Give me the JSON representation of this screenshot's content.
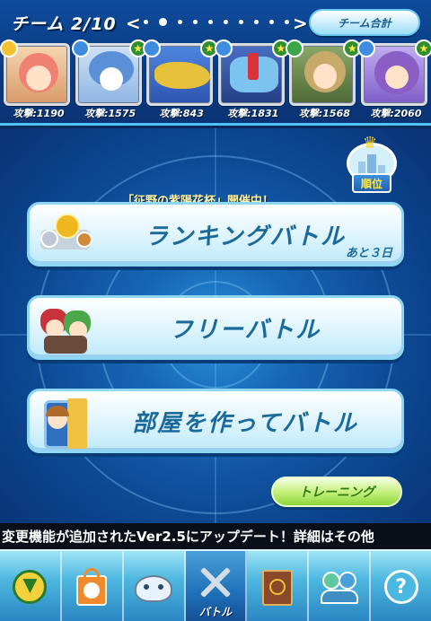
{
  "header": {
    "team_label": "チーム 2/10",
    "prev_arrow": "<",
    "next_arrow": ">",
    "team_total_button": "チーム合計",
    "page_dots": 10,
    "active_dot": 2
  },
  "team": [
    {
      "atk": "攻撃:1190",
      "attr_color": "#f2c230",
      "hair": "#f08070",
      "bg": "#e9b38a"
    },
    {
      "atk": "攻撃:1575",
      "attr_color": "#3f8de0",
      "hair": "#5b8fd8",
      "bg": "#9ec0e8"
    },
    {
      "atk": "攻撃:843",
      "attr_color": "#3f8de0",
      "hair": "#e8c13a",
      "bg": "#3b6fd0"
    },
    {
      "atk": "攻撃:1831",
      "attr_color": "#3f8de0",
      "hair": "#7cc3f0",
      "bg": "#3a5fb0"
    },
    {
      "atk": "攻撃:1568",
      "attr_color": "#3aa64a",
      "hair": "#c7a96a",
      "bg": "#6a8a4a"
    },
    {
      "atk": "攻撃:2060",
      "attr_color": "#3f8de0",
      "hair": "#8a5ec4",
      "bg": "#9c7bd8"
    }
  ],
  "ranking_badge": "順位",
  "event_notice": "「征野の紫陽花杯」開催中！",
  "menu": {
    "ranking_battle": "ランキングバトル",
    "ranking_remaining": "あと３日",
    "free_battle": "フリーバトル",
    "room_battle": "部屋を作ってバトル",
    "training": "トレーニング"
  },
  "ticker": "変更機能が追加されたVer2.5にアップデート！詳細はその他",
  "nav": {
    "battle_label": "バトル"
  },
  "colors": {
    "accent": "#4fc3f7",
    "menu_text": "#1b6a9c",
    "training_green": "#8ed63c"
  }
}
